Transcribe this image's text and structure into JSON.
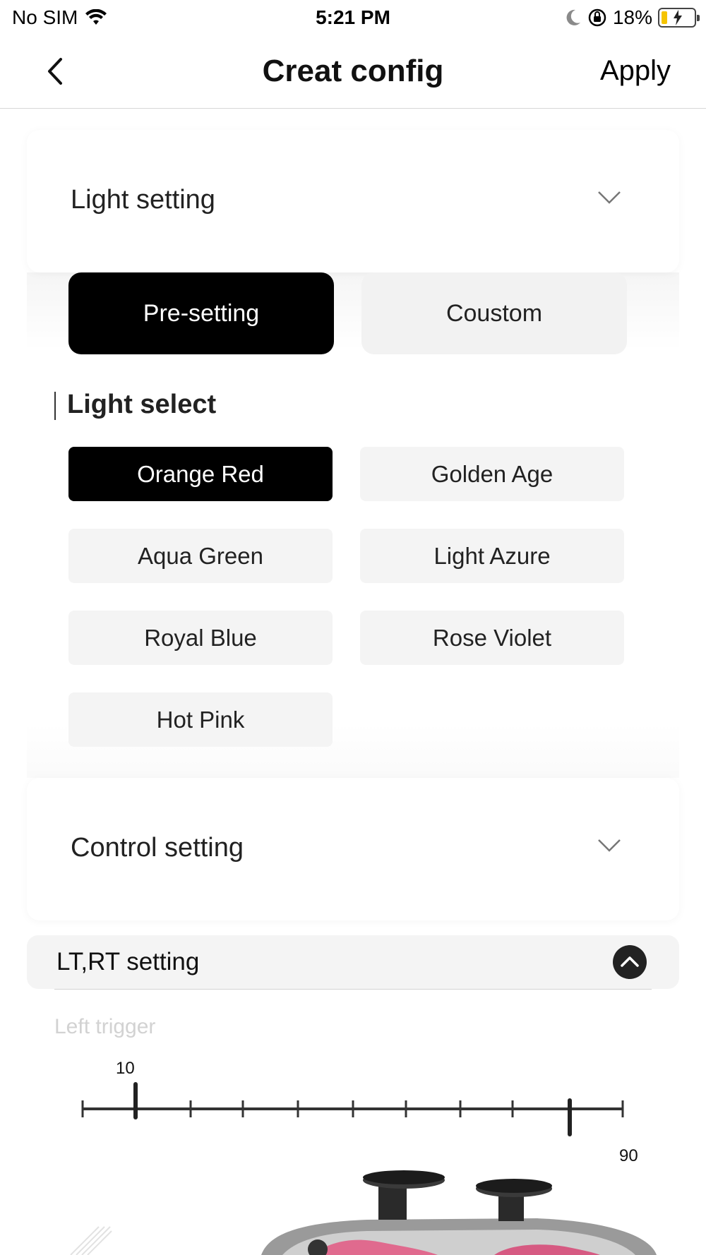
{
  "status": {
    "carrier": "No SIM",
    "time": "5:21 PM",
    "battery_pct": "18%",
    "battery_level": 0.18,
    "icons": [
      "wifi-icon",
      "moon-icon",
      "orientation-lock-icon",
      "battery-charging-icon"
    ]
  },
  "nav": {
    "title": "Creat config",
    "apply_label": "Apply"
  },
  "light_setting": {
    "title": "Light setting",
    "modes": [
      "Pre-setting",
      "Coustom"
    ],
    "active_mode": "Pre-setting",
    "select_title": "Light select",
    "colors": [
      "Orange Red",
      "Golden Age",
      "Aqua Green",
      "Light Azure",
      "Royal Blue",
      "Rose Violet",
      "Hot Pink"
    ],
    "selected_color": "Orange Red"
  },
  "control_setting": {
    "title": "Control setting"
  },
  "ltrt": {
    "title": "LT,RT setting",
    "left_trigger_label": "Left trigger",
    "min_value": "10",
    "max_value": "90"
  },
  "colors": {
    "accent": "#000000",
    "button_bg": "#f4f4f4",
    "battery": "#f5c400"
  }
}
